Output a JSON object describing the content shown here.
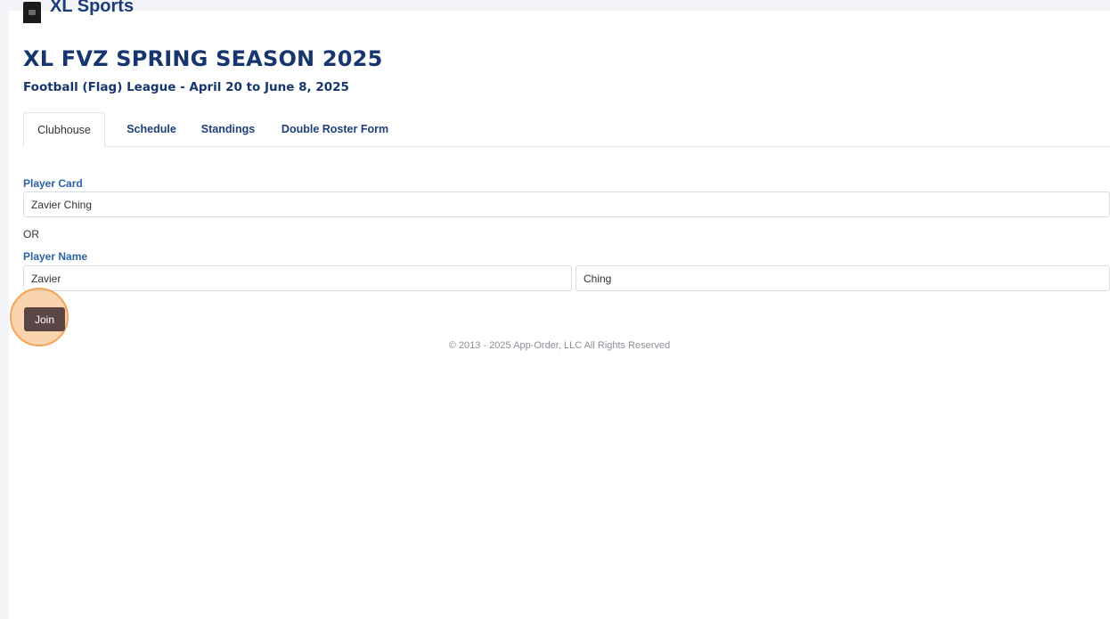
{
  "brand": {
    "name": "XL Sports",
    "logo_icon": "team-logo-icon"
  },
  "header": {
    "title": "XL FVZ SPRING SEASON 2025",
    "subtitle": "Football (Flag) League  -  April 20 to June 8, 2025"
  },
  "tabs": [
    {
      "label": "Clubhouse",
      "active": true
    },
    {
      "label": "Schedule",
      "active": false
    },
    {
      "label": "Standings",
      "active": false
    },
    {
      "label": "Double Roster Form",
      "active": false
    }
  ],
  "form": {
    "player_card_label": "Player Card",
    "player_card_value": "Zavier Ching",
    "or_text": "OR",
    "player_name_label": "Player Name",
    "first_name_value": "Zavier",
    "last_name_value": "Ching",
    "join_label": "Join"
  },
  "footer": {
    "copyright": "© 2013 - 2025 App-Order, LLC All Rights Reserved"
  },
  "colors": {
    "title": "#17366f",
    "label": "#2a63a8",
    "join_button": "#5b4646",
    "highlight_ring": "#f3a55a"
  }
}
